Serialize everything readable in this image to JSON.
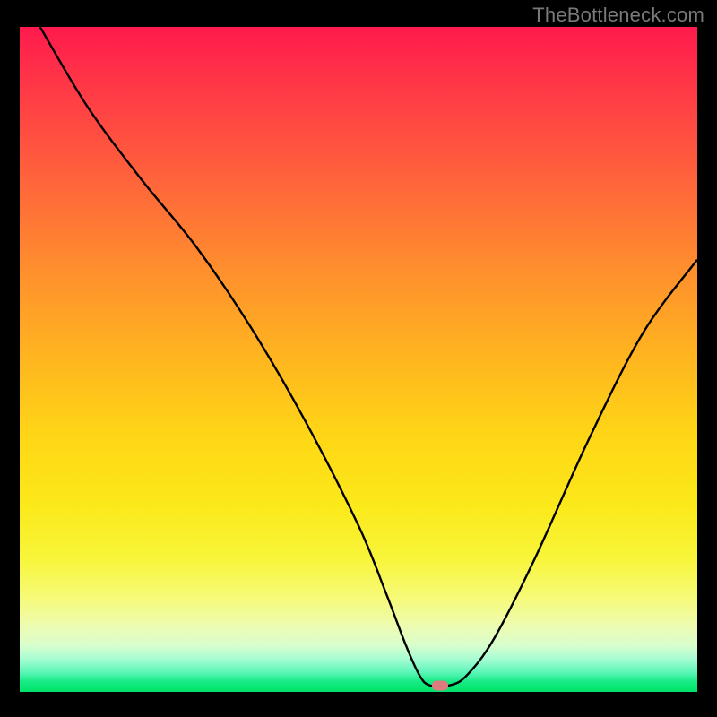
{
  "watermark": "TheBottleneck.com",
  "chart_data": {
    "type": "line",
    "title": "",
    "xlabel": "",
    "ylabel": "",
    "x_range": [
      0,
      100
    ],
    "y_range": [
      0,
      100
    ],
    "series": [
      {
        "name": "bottleneck-curve",
        "x": [
          3,
          10,
          18,
          26,
          34,
          42,
          50,
          54,
          57,
          59,
          60.5,
          63.5,
          66,
          70,
          76,
          84,
          92,
          100
        ],
        "y": [
          100,
          88,
          77,
          67,
          55,
          41,
          25,
          15,
          7,
          2.5,
          1,
          1,
          2.5,
          8,
          20,
          38,
          54,
          65
        ]
      }
    ],
    "marker": {
      "x": 62,
      "y": 1
    },
    "gradient_stops": [
      {
        "pos": 0,
        "color": "#ff1a4d"
      },
      {
        "pos": 50,
        "color": "#ffd716"
      },
      {
        "pos": 90,
        "color": "#eefcb0"
      },
      {
        "pos": 100,
        "color": "#00e268"
      }
    ]
  }
}
